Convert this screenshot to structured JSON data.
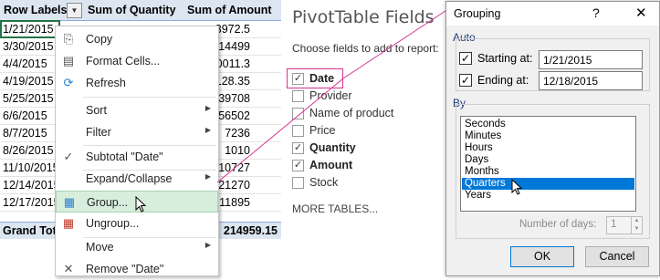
{
  "pivot": {
    "header": {
      "row_labels": "Row Labels",
      "sum_quantity": "Sum of Quantity",
      "sum_amount": "Sum of Amount"
    },
    "rows": [
      {
        "date": "1/21/2015",
        "amount": "3972.5"
      },
      {
        "date": "3/30/2015",
        "amount": "14499"
      },
      {
        "date": "4/4/2015",
        "amount": "40011.3"
      },
      {
        "date": "4/19/2015",
        "amount": "8128.35"
      },
      {
        "date": "5/25/2015",
        "amount": "39708"
      },
      {
        "date": "6/6/2015",
        "amount": "56502"
      },
      {
        "date": "8/7/2015",
        "amount": "7236"
      },
      {
        "date": "8/26/2015",
        "amount": "1010"
      },
      {
        "date": "11/10/2015",
        "amount": "10727"
      },
      {
        "date": "12/14/2015",
        "amount": "21270"
      },
      {
        "date": "12/17/2015",
        "amount": "11895"
      }
    ],
    "grand_total": {
      "label": "Grand Total",
      "amount": "214959.15"
    }
  },
  "context_menu": {
    "items": [
      {
        "label": "Copy",
        "icon": "copy-icon"
      },
      {
        "label": "Format Cells...",
        "icon": "format-cells-icon"
      },
      {
        "label": "Refresh",
        "icon": "refresh-icon"
      },
      {
        "label": "Sort",
        "icon": "",
        "submenu": true
      },
      {
        "label": "Filter",
        "icon": "",
        "submenu": true
      },
      {
        "label": "Subtotal \"Date\"",
        "icon": "check-icon"
      },
      {
        "label": "Expand/Collapse",
        "icon": "",
        "submenu": true
      },
      {
        "label": "Group...",
        "icon": "group-icon"
      },
      {
        "label": "Ungroup...",
        "icon": "ungroup-icon"
      },
      {
        "label": "Move",
        "icon": "",
        "submenu": true
      },
      {
        "label": "Remove \"Date\"",
        "icon": "remove-icon"
      }
    ]
  },
  "field_list": {
    "title": "PivotTable Fields",
    "subtitle": "Choose fields to add to report:",
    "fields": [
      {
        "label": "Date",
        "checked": true
      },
      {
        "label": "Provider",
        "checked": false
      },
      {
        "label": "Name of product",
        "checked": false
      },
      {
        "label": "Price",
        "checked": false
      },
      {
        "label": "Quantity",
        "checked": true
      },
      {
        "label": "Amount",
        "checked": true
      },
      {
        "label": "Stock",
        "checked": false
      }
    ],
    "more_tables": "MORE TABLES..."
  },
  "dialog": {
    "title": "Grouping",
    "help": "?",
    "close": "✕",
    "auto_label": "Auto",
    "starting_label": "Starting at:",
    "starting_value": "1/21/2015",
    "ending_label": "Ending at:",
    "ending_value": "12/18/2015",
    "by_label": "By",
    "by_options": [
      "Seconds",
      "Minutes",
      "Hours",
      "Days",
      "Months",
      "Quarters",
      "Years"
    ],
    "selected_option": "Quarters",
    "number_of_days_label": "Number of days:",
    "number_of_days_value": "1",
    "ok": "OK",
    "cancel": "Cancel"
  },
  "colors": {
    "accent": "#217346",
    "highlight": "#d8eedd",
    "selection": "#0078d7",
    "guide": "#d6338f"
  }
}
